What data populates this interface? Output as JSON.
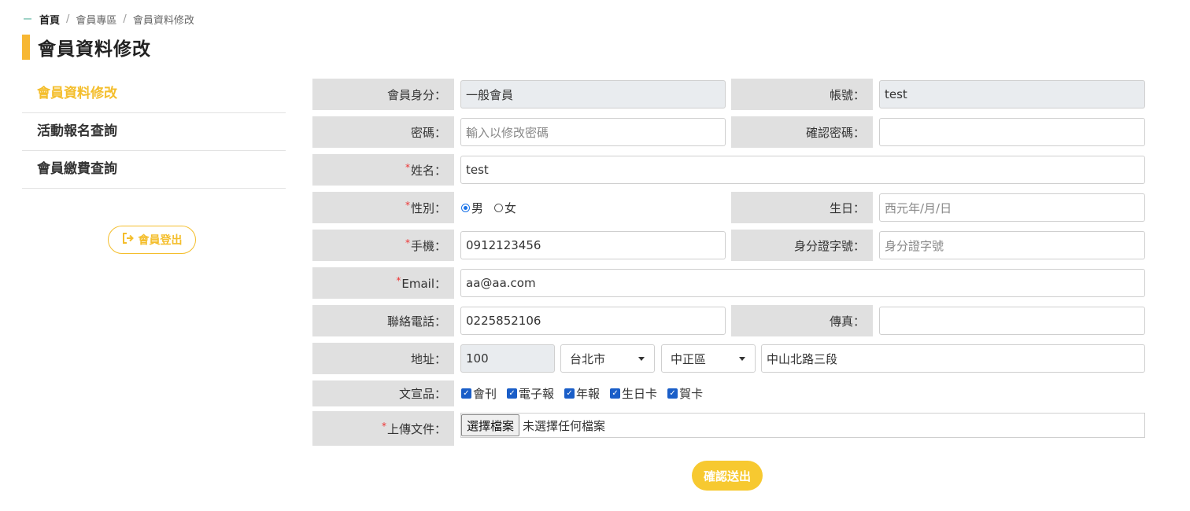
{
  "breadcrumb": {
    "home": "首頁",
    "section": "會員專區",
    "current": "會員資料修改",
    "separator": "/"
  },
  "page_title": "會員資料修改",
  "sidebar": {
    "items": [
      {
        "label": "會員資料修改",
        "active": true
      },
      {
        "label": "活動報名查詢",
        "active": false
      },
      {
        "label": "會員繳費查詢",
        "active": false
      }
    ],
    "logout_label": "會員登出",
    "logout_icon": "sign-out-icon"
  },
  "form": {
    "member_type": {
      "label": "會員身分：",
      "value": "一般會員"
    },
    "account": {
      "label": "帳號：",
      "value": "test"
    },
    "password": {
      "label": "密碼：",
      "placeholder": "輸入以修改密碼",
      "value": ""
    },
    "confirm_password": {
      "label": "確認密碼：",
      "value": ""
    },
    "name": {
      "label": "姓名：",
      "required": "*",
      "value": "test"
    },
    "gender": {
      "label": "性別：",
      "required": "*",
      "options": [
        "男",
        "女"
      ],
      "selected": "男"
    },
    "birthday": {
      "label": "生日：",
      "placeholder": "西元年/月/日",
      "value": ""
    },
    "mobile": {
      "label": "手機：",
      "required": "*",
      "value": "0912123456"
    },
    "id_number": {
      "label": "身分證字號：",
      "placeholder": "身分證字號",
      "value": ""
    },
    "email": {
      "label": "Email：",
      "required": "*",
      "value": "aa@aa.com"
    },
    "phone": {
      "label": "聯絡電話：",
      "value": "0225852106"
    },
    "fax": {
      "label": "傳真：",
      "value": ""
    },
    "address": {
      "label": "地址：",
      "zip": "100",
      "city": "台北市",
      "district": "中正區",
      "street": "中山北路三段"
    },
    "publications": {
      "label": "文宣品：",
      "items": [
        {
          "label": "會刊",
          "checked": true
        },
        {
          "label": "電子報",
          "checked": true
        },
        {
          "label": "年報",
          "checked": true
        },
        {
          "label": "生日卡",
          "checked": true
        },
        {
          "label": "賀卡",
          "checked": true
        }
      ]
    },
    "upload": {
      "label": "上傳文件：",
      "required": "*",
      "button_label": "選擇檔案",
      "status": "未選擇任何檔案"
    }
  },
  "submit_label": "確認送出",
  "colors": {
    "accent": "#f4be2c",
    "label_bg": "#e0e0e0",
    "required": "#e33333",
    "check": "#1a5ec8"
  }
}
